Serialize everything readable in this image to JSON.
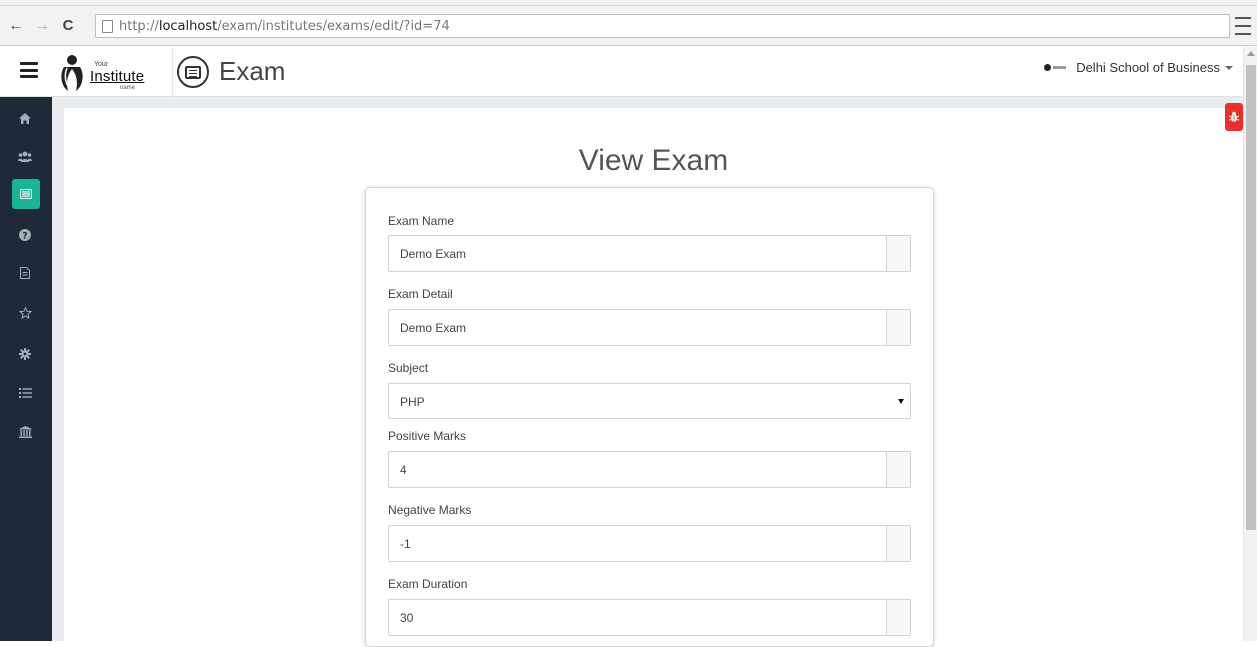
{
  "browser": {
    "url_prefix": "http://",
    "url_host": "localhost",
    "url_path": "/exam/institutes/exams/edit/?id=74"
  },
  "header": {
    "logo_your": "Your",
    "logo_institute": "Institute",
    "logo_name": "name",
    "title": "Exam",
    "user_name": "Delhi School of Business"
  },
  "sidebar": {
    "items": [
      {
        "icon": "home-icon",
        "glyph": "⌂",
        "active": false
      },
      {
        "icon": "users-icon",
        "glyph": "👥",
        "active": false
      },
      {
        "icon": "exam-list-icon",
        "glyph": "▤",
        "active": true
      },
      {
        "icon": "question-icon",
        "glyph": "❓",
        "active": false
      },
      {
        "icon": "document-icon",
        "glyph": "▤",
        "active": false
      },
      {
        "icon": "star-icon",
        "glyph": "☆",
        "active": false
      },
      {
        "icon": "gear-icon",
        "glyph": "✲",
        "active": false
      },
      {
        "icon": "list-icon",
        "glyph": "☰",
        "active": false
      },
      {
        "icon": "institution-icon",
        "glyph": "🏛",
        "active": false
      }
    ]
  },
  "bug_icon": "bug-icon",
  "page": {
    "heading": "View Exam"
  },
  "form": {
    "exam_name": {
      "label": "Exam Name",
      "value": "Demo Exam"
    },
    "exam_detail": {
      "label": "Exam Detail",
      "value": "Demo Exam"
    },
    "subject": {
      "label": "Subject",
      "value": "PHP"
    },
    "positive_marks": {
      "label": "Positive Marks",
      "value": "4"
    },
    "negative_marks": {
      "label": "Negative Marks",
      "value": "-1"
    },
    "exam_duration": {
      "label": "Exam Duration",
      "value": "30"
    }
  },
  "colors": {
    "sidebar_bg": "#1e2a38",
    "accent": "#1ab394",
    "bug_badge": "#e8312d"
  }
}
